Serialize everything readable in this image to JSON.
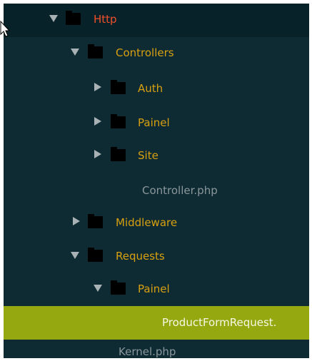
{
  "tree": {
    "items": [
      {
        "label": "Http",
        "type": "folder",
        "expanded": true,
        "color": "#f0502a"
      },
      {
        "label": "Controllers",
        "type": "folder",
        "expanded": true,
        "color": "#d8a010"
      },
      {
        "label": "Auth",
        "type": "folder",
        "expanded": false,
        "color": "#d8a010"
      },
      {
        "label": "Painel",
        "type": "folder",
        "expanded": false,
        "color": "#d8a010"
      },
      {
        "label": "Site",
        "type": "folder",
        "expanded": false,
        "color": "#d8a010"
      },
      {
        "label": "Controller.php",
        "type": "file",
        "color": "#8a979b"
      },
      {
        "label": "Middleware",
        "type": "folder",
        "expanded": false,
        "color": "#d8a010"
      },
      {
        "label": "Requests",
        "type": "folder",
        "expanded": true,
        "color": "#d8a010"
      },
      {
        "label": "Painel",
        "type": "folder",
        "expanded": true,
        "color": "#d8a010"
      },
      {
        "label": "ProductFormRequest.",
        "type": "file",
        "selected": true,
        "color": "#f4f8e4"
      },
      {
        "label": "Kernel.php",
        "type": "file",
        "color": "#8a979b"
      }
    ]
  },
  "colors": {
    "background": "#0e2b33",
    "selected_row": "#96a810",
    "arrow": "#a8b1b4",
    "folder_icon": "#000000"
  }
}
